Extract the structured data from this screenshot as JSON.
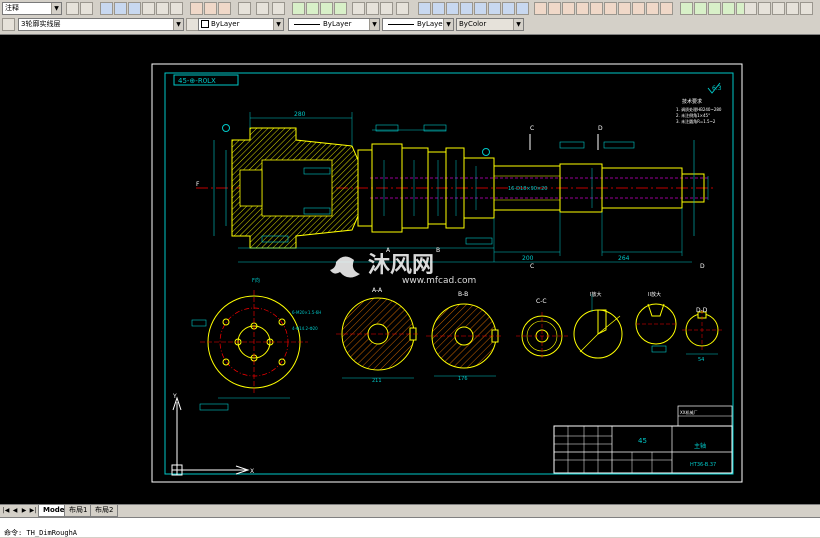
{
  "toolbar": {
    "annotate_combo": "注释",
    "layer_combo": "3轮廓实线层",
    "color_combo": "ByLayer",
    "linetype_combo": "ByLayer",
    "lineweight_combo": "ByLayer",
    "plotstyle_combo": "ByColor"
  },
  "drawing": {
    "part_code": "45-⊕-R0LX",
    "roughness_top": "6.3",
    "notes_title": "技术要求",
    "note_1": "1. 调质处理HB240~280",
    "note_2": "2. 未注倒角1×45°",
    "note_3": "3. 未注圆角R=1.5~2",
    "top_dim_1": "280",
    "top_dim_2": "200",
    "top_dim_3": "264",
    "spline_label": "16-D18×90×20",
    "section_a_label": "A-A",
    "section_b_label": "B-B",
    "section_c_label": "C-C",
    "section_d_label": "D-D",
    "view_i_label": "I放大",
    "view_ii_label": "II放大",
    "view_f_label": "F向",
    "dim_211": "211",
    "dim_176": "176",
    "dim_54": "54",
    "hole_note_1": "6-M20×1.5-6H",
    "hole_note_2": "4-Φ14.2-Φ20",
    "title_material": "45",
    "title_name": "主轴",
    "title_code": "HT36-B.37",
    "company": "XX机械厂"
  },
  "watermark": {
    "brand": "沐风网",
    "url": "www.mfcad.com"
  },
  "layout_tabs": [
    "Model",
    "布局1",
    "布局2"
  ],
  "command_line": {
    "line_1": "",
    "line_2": "命令: TH_DimRoughA"
  }
}
